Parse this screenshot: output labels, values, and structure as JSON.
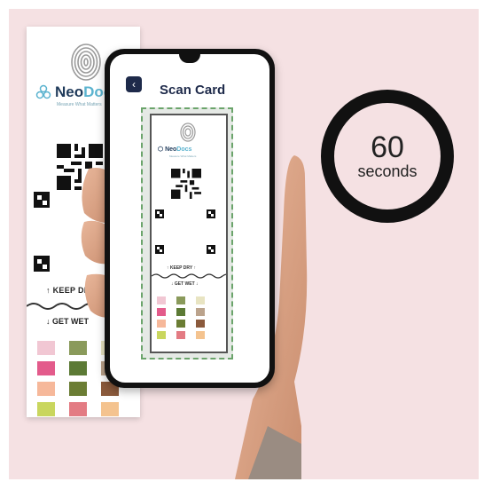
{
  "brand": {
    "name_main": "Neo",
    "name_accent": "Docs",
    "tagline": "Measure What Matters"
  },
  "strip": {
    "keep_dry": "KEEP DRY",
    "get_wet": "GET WET"
  },
  "app": {
    "screen_title": "Scan Card",
    "back_icon": "chevron-left-icon"
  },
  "timer": {
    "value": "60",
    "unit": "seconds"
  },
  "colors": {
    "background": "#f5e1e3",
    "accent_navy": "#1e2a4a",
    "accent_teal": "#5bb3cf",
    "scan_frame": "#6ba46b"
  },
  "test_pads": [
    "#f1c7d3",
    "#8a9a5b",
    "#e8e4c2",
    "#e35b8b",
    "#5c7a35",
    "#bba38c",
    "#f6b89a",
    "#6b7d34",
    "#8b5a3c",
    "#c9d65e",
    "#e37b83",
    "#f4c38f"
  ]
}
